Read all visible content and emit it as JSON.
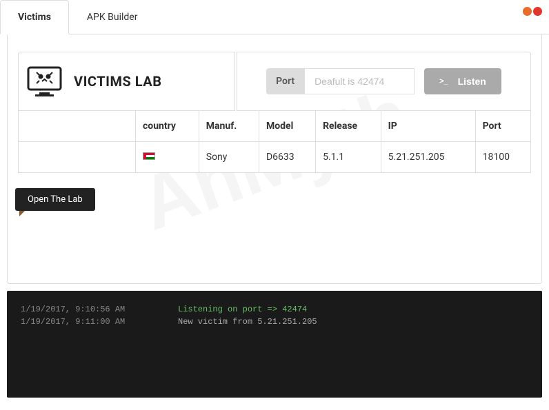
{
  "tabs": [
    {
      "label": "Victims",
      "active": true
    },
    {
      "label": "APK Builder",
      "active": false
    }
  ],
  "traffic_lights": [
    "#e86c2b",
    "#e2352c"
  ],
  "watermark": "AhMyth",
  "header": {
    "title": "VICTIMS LAB",
    "port_label": "Port",
    "port_placeholder": "Deafult is 42474",
    "listen_label": "Listen"
  },
  "tooltip": "Open The Lab",
  "table": {
    "columns": [
      "",
      "country",
      "Manuf.",
      "Model",
      "Release",
      "IP",
      "Port"
    ],
    "rows": [
      {
        "country_flag": "oman",
        "manuf": "Sony",
        "model": "D6633",
        "release": "5.1.1",
        "ip": "5.21.251.205",
        "port": "18100"
      }
    ]
  },
  "console": [
    {
      "time": "1/19/2017, 9:10:56 AM",
      "msg": "Listening on port => 42474",
      "color": "green"
    },
    {
      "time": "1/19/2017, 9:11:00 AM",
      "msg": "New victim from 5.21.251.205",
      "color": "normal"
    }
  ]
}
